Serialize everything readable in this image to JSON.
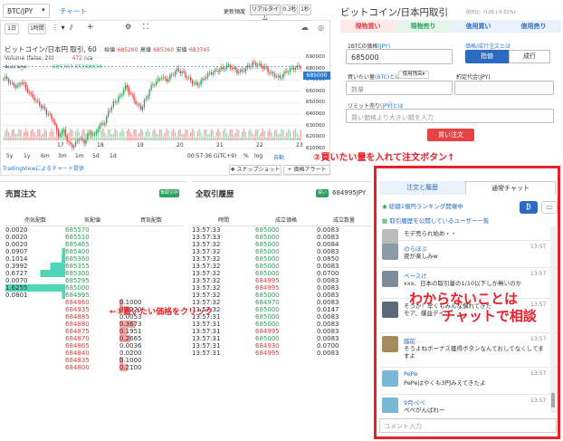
{
  "header": {
    "pair": "BTC/JPY",
    "chart_tab": "チャート",
    "update_label": "更新頻度",
    "realtime": "リアルタイム",
    "sec03": "0.3秒",
    "sec1": "1秒"
  },
  "chart_toolbar": {
    "day": "1日",
    "hour": "1時間"
  },
  "chart": {
    "title": "ビットコイン/日本円 取引, 60",
    "o_label": "始値",
    "o": "685260",
    "h_label": "高値",
    "h": "685360",
    "l_label": "安値",
    "l": "683745",
    "volume_label": "Volume (false, 20)",
    "volume_value": "472",
    "volume_na": "n/a",
    "average_label": "Average",
    "average_value": "685263.65268026",
    "current_price": "685000",
    "y_ticks": [
      "690000",
      "680000",
      "670000",
      "660000",
      "650000",
      "640000",
      "630000",
      "620000",
      "610000"
    ],
    "x_ticks": [
      "17",
      "18",
      "19",
      "20",
      "21",
      "22",
      "23"
    ],
    "ranges": [
      "5y",
      "1y",
      "6m",
      "3m",
      "1m",
      "5d",
      "1d"
    ],
    "clock": "00:57:36 (UTC+9)",
    "pct": "%",
    "log": "log",
    "auto": "自動",
    "provided_by": "TradingViewによるチャート提供",
    "snapshot": "スナップショット",
    "alert": "価格アラート",
    "price_series": [
      675,
      670,
      668,
      672,
      665,
      660,
      655,
      650,
      645,
      640,
      628,
      632,
      620,
      618,
      625,
      622,
      630,
      628,
      635,
      638,
      650,
      656,
      660,
      668,
      662,
      655,
      650,
      658,
      668,
      672,
      676,
      674,
      678,
      682,
      680,
      676,
      672,
      670,
      674,
      678,
      680,
      682,
      684,
      686,
      683,
      680,
      682,
      686,
      688,
      686,
      684,
      680,
      678,
      676,
      680,
      682,
      684,
      685
    ]
  },
  "trade_panel": {
    "pair_title": "ビットコイン/日本円取引",
    "ticker": "前日比: -0.05 (-0.01%)",
    "tabs": [
      "現物買い",
      "現物売り",
      "信用買い",
      "信用売り"
    ],
    "rate_label": "1BTCの価格",
    "rate_link": "(JPY)",
    "rate_value": "685000",
    "order_type_label": "価格/成行注文とは",
    "limit": "指値",
    "market": "成行",
    "amount_label": "買いたい量",
    "amount_link": "(BTC)とは",
    "use_funds": "使用残高",
    "amount_placeholder": "数量",
    "estimate_label": "約定代金",
    "estimate_unit": "(JPY)",
    "stop_label": "リミット売り",
    "stop_link": "(JPY)とは",
    "stop_placeholder": "買い価格より大きい額を入力",
    "buy_button": "買い注文"
  },
  "annotations": {
    "amount_hint": "②買いたい量を入れて注文ボタン↑",
    "price_hint": "←①買いたい価格をクリック",
    "chat_hint_1": "わからないことは",
    "chat_hint_2": "チャットで相談"
  },
  "orderbook": {
    "title": "売買注文",
    "badge": "板取引中",
    "headers": [
      "売気配数",
      "気配値",
      "買気配数"
    ],
    "asks": [
      {
        "qty": "0.0020",
        "price": "685570",
        "bar": 0.0
      },
      {
        "qty": "0.0020",
        "price": "685510",
        "bar": 0.0
      },
      {
        "qty": "0.0020",
        "price": "685465",
        "bar": 0.0
      },
      {
        "qty": "0.0907",
        "price": "685400",
        "bar": 0.05
      },
      {
        "qty": "0.1014",
        "price": "685360",
        "bar": 0.06
      },
      {
        "qty": "0.3992",
        "price": "685355",
        "bar": 0.25
      },
      {
        "qty": "0.6727",
        "price": "685300",
        "bar": 0.42
      },
      {
        "qty": "0.0070",
        "price": "685295",
        "bar": 0.0
      },
      {
        "qty": "1.6255",
        "price": "685000",
        "bar": 1.0
      },
      {
        "qty": "0.0801",
        "price": "684995",
        "bar": 0.05
      }
    ],
    "bids": [
      {
        "price": "684960",
        "qty": "0.1000",
        "bar": 0.06
      },
      {
        "price": "684935",
        "qty": "0.2220",
        "bar": 0.14
      },
      {
        "price": "684885",
        "qty": "0.0053",
        "bar": 0.0
      },
      {
        "price": "684880",
        "qty": "0.3673",
        "bar": 0.25
      },
      {
        "price": "684875",
        "qty": "0.1951",
        "bar": 0.12
      },
      {
        "price": "684870",
        "qty": "0.2665",
        "bar": 0.17
      },
      {
        "price": "684865",
        "qty": "0.0036",
        "bar": 0.0
      },
      {
        "price": "684840",
        "qty": "0.0200",
        "bar": 0.0
      },
      {
        "price": "684835",
        "qty": "0.1000",
        "bar": 0.06
      },
      {
        "price": "684800",
        "qty": "0.2100",
        "bar": 0.13
      }
    ]
  },
  "trades": {
    "title": "全取引履歴",
    "buy_badge": "買い",
    "last_price": "684995JPY",
    "headers": [
      "時間",
      "成立価格",
      "成立数量"
    ],
    "rows": [
      {
        "t": "13:57:33",
        "p": "685000",
        "q": "0.0083",
        "side": "buy"
      },
      {
        "t": "13:57:33",
        "p": "685000",
        "q": "0.0083",
        "side": "buy"
      },
      {
        "t": "13:57:32",
        "p": "685000",
        "q": "0.0084",
        "side": "buy"
      },
      {
        "t": "13:57:32",
        "p": "685000",
        "q": "0.0083",
        "side": "buy"
      },
      {
        "t": "13:57:32",
        "p": "685000",
        "q": "0.0850",
        "side": "buy"
      },
      {
        "t": "13:57:32",
        "p": "685000",
        "q": "0.0083",
        "side": "buy"
      },
      {
        "t": "13:57:32",
        "p": "685000",
        "q": "0.0700",
        "side": "buy"
      },
      {
        "t": "13:57:32",
        "p": "684995",
        "q": "0.0083",
        "side": "sell"
      },
      {
        "t": "13:57:32",
        "p": "684995",
        "q": "0.0083",
        "side": "sell"
      },
      {
        "t": "13:57:32",
        "p": "685000",
        "q": "0.0083",
        "side": "buy"
      },
      {
        "t": "13:57:32",
        "p": "684970",
        "q": "0.0083",
        "side": "buy"
      },
      {
        "t": "13:57:32",
        "p": "685000",
        "q": "0.0147",
        "side": "buy"
      },
      {
        "t": "13:57:31",
        "p": "685000",
        "q": "0.0083",
        "side": "buy"
      },
      {
        "t": "13:57:31",
        "p": "685000",
        "q": "0.0083",
        "side": "buy"
      },
      {
        "t": "13:57:31",
        "p": "684995",
        "q": "0.0083",
        "side": "sell"
      },
      {
        "t": "13:57:31",
        "p": "685000",
        "q": "0.0083",
        "side": "buy"
      },
      {
        "t": "13:57:31",
        "p": "684930",
        "q": "0.0700",
        "side": "sell"
      },
      {
        "t": "13:57:31",
        "p": "684995",
        "q": "0.0083",
        "side": "sell"
      }
    ]
  },
  "chat": {
    "tabs": [
      "注文と履歴",
      "通常チャット"
    ],
    "ranking": "総額1億円ランキング開催中",
    "public_users": "取引履歴を公開しているユーザー一覧",
    "messages": [
      {
        "name": "",
        "text": "モデ売られ始め・・",
        "time": ""
      },
      {
        "name": "のらぼぶ",
        "text": "夜が楽しみw",
        "time": "13:57"
      },
      {
        "name": "ベースけ",
        "text": "xxx、日本の取引量の1/10以下しか無いのか",
        "time": "13:57"
      },
      {
        "name": "",
        "text": "そうか！早くもみんな慣れてきた\nモア、爆益デイ",
        "time": "13:57"
      },
      {
        "name": "越前",
        "text": "そうよねボーナス獲得ボタンなんておしてなくしてますよ",
        "time": "13:57"
      },
      {
        "name": "PePe",
        "text": "PePeはやくも3円みえてきたよ",
        "time": "13:57"
      },
      {
        "name": "9月ペペ",
        "text": "ぺぺがんばれー",
        "time": "13:57"
      }
    ],
    "input_placeholder": "コメント入力"
  }
}
